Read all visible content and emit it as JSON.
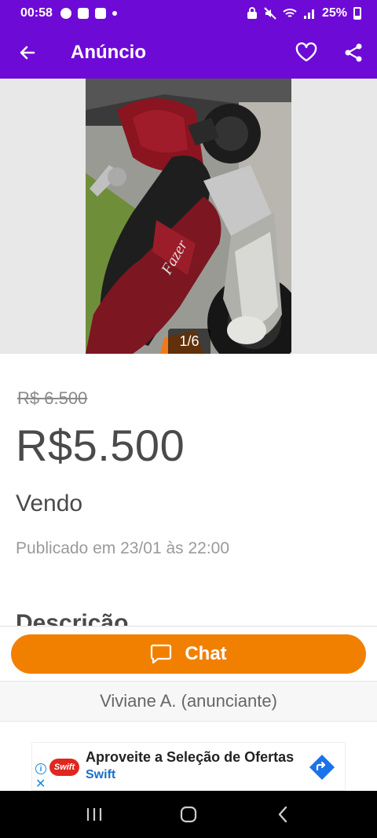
{
  "status_bar": {
    "time": "00:58",
    "battery": "25%"
  },
  "app_bar": {
    "title": "Anúncio"
  },
  "gallery": {
    "counter": "1/6"
  },
  "listing": {
    "old_price": "R$ 6.500",
    "price": "R$5.500",
    "title": "Vendo",
    "published": "Publicado em 23/01 às 22:00",
    "description_heading": "Descrição"
  },
  "chat": {
    "label": "Chat"
  },
  "advertiser": {
    "label": "Viviane A. (anunciante)"
  },
  "ad_banner": {
    "logo_text": "Swift",
    "headline": "Aproveite a Seleção de Ofertas",
    "brand": "Swift"
  },
  "colors": {
    "brand_purple": "#6e0ad6",
    "chat_orange": "#f28000"
  }
}
